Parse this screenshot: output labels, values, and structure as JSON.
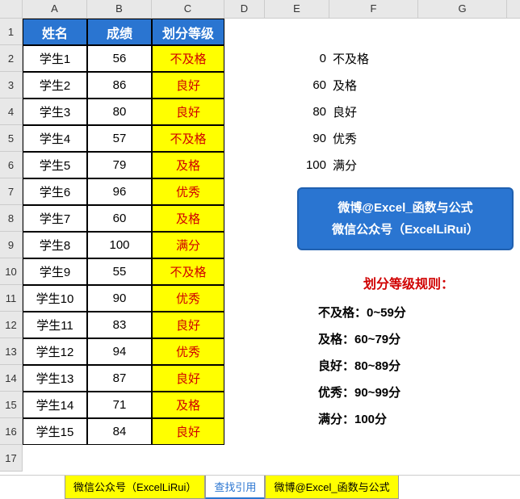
{
  "columns": [
    "A",
    "B",
    "C",
    "D",
    "E",
    "F",
    "G"
  ],
  "headers": {
    "name": "姓名",
    "score": "成绩",
    "grade": "划分等级"
  },
  "students": [
    {
      "name": "学生1",
      "score": 56,
      "grade": "不及格"
    },
    {
      "name": "学生2",
      "score": 86,
      "grade": "良好"
    },
    {
      "name": "学生3",
      "score": 80,
      "grade": "良好"
    },
    {
      "name": "学生4",
      "score": 57,
      "grade": "不及格"
    },
    {
      "name": "学生5",
      "score": 79,
      "grade": "及格"
    },
    {
      "name": "学生6",
      "score": 96,
      "grade": "优秀"
    },
    {
      "name": "学生7",
      "score": 60,
      "grade": "及格"
    },
    {
      "name": "学生8",
      "score": 100,
      "grade": "满分"
    },
    {
      "name": "学生9",
      "score": 55,
      "grade": "不及格"
    },
    {
      "name": "学生10",
      "score": 90,
      "grade": "优秀"
    },
    {
      "name": "学生11",
      "score": 83,
      "grade": "良好"
    },
    {
      "name": "学生12",
      "score": 94,
      "grade": "优秀"
    },
    {
      "name": "学生13",
      "score": 87,
      "grade": "良好"
    },
    {
      "name": "学生14",
      "score": 71,
      "grade": "及格"
    },
    {
      "name": "学生15",
      "score": 84,
      "grade": "良好"
    }
  ],
  "lookup": [
    {
      "threshold": 0,
      "label": "不及格"
    },
    {
      "threshold": 60,
      "label": "及格"
    },
    {
      "threshold": 80,
      "label": "良好"
    },
    {
      "threshold": 90,
      "label": "优秀"
    },
    {
      "threshold": 100,
      "label": "满分"
    }
  ],
  "promo": {
    "line1": "微博@Excel_函数与公式",
    "line2": "微信公众号（ExcelLiRui）"
  },
  "rules": {
    "title": "划分等级规则：",
    "lines": [
      "不及格：0~59分",
      "及格：60~79分",
      "良好：80~89分",
      "优秀：90~99分",
      "满分：100分"
    ]
  },
  "tabs": [
    {
      "label": "微信公众号（ExcelLiRui）",
      "style": "yellow"
    },
    {
      "label": "查找引用",
      "style": "active"
    },
    {
      "label": "微博@Excel_函数与公式",
      "style": "yellow"
    }
  ]
}
